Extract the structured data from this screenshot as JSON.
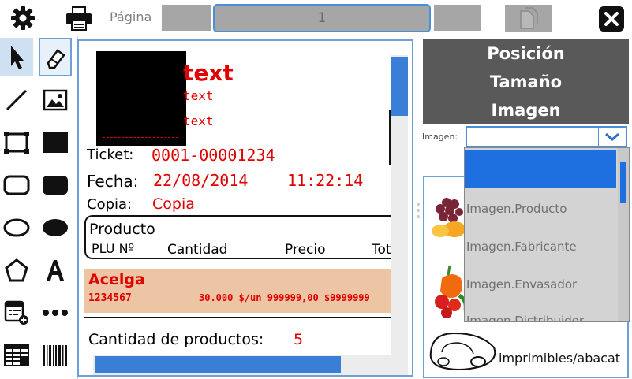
{
  "topbar": {
    "page_label": "Página",
    "page_value": "1"
  },
  "canvas": {
    "header_lines": [
      "text",
      "text",
      "text"
    ],
    "ticket_label": "Ticket:",
    "ticket_value": "0001-00001234",
    "fecha_label": "Fecha:",
    "fecha_date": "22/08/2014",
    "fecha_time": "11:22:14",
    "copia_label": "Copia:",
    "copia_value": "Copia",
    "table_title": "Producto",
    "col_plu": "PLU Nº",
    "col_cantidad": "Cantidad",
    "col_precio": "Precio",
    "col_total": "Tot",
    "item_name": "Acelga",
    "item_code": "1234567",
    "item_detail": "30.000  $/un 999999,00 $9999999",
    "count_label": "Cantidad de productos:",
    "count_value": "5"
  },
  "right_panel": {
    "menu": [
      "Posición",
      "Tamaño",
      "Imagen"
    ],
    "imagen_label": "Imagen:",
    "selected_value": "",
    "options": [
      "",
      "Imagen.Producto",
      "Imagen.Fabricante",
      "Imagen.Envasador",
      "Imagen.Distribuidor"
    ],
    "gallery_caption": "imprimibles/abacat"
  },
  "colors": {
    "accent": "#4a90d9",
    "selected_row": "#1e6fe0",
    "item_bg": "#edc4a4",
    "value_red": "#e00000",
    "panel_header": "#595959"
  }
}
